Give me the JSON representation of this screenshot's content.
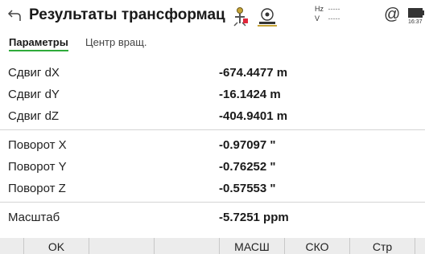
{
  "header": {
    "title": "Результаты трансформац",
    "hz_label": "Hz",
    "hz_value": "-----",
    "v_label": "V",
    "v_value": "-----",
    "at_symbol": "@",
    "time": "16:37",
    "icons": [
      "back-icon",
      "prism-target-icon",
      "instrument-icon",
      "battery-icon"
    ]
  },
  "tabs": [
    {
      "label": "Параметры",
      "active": true
    },
    {
      "label": "Центр вращ.",
      "active": false
    }
  ],
  "rows": [
    {
      "label": "Сдвиг dX",
      "value": "-674.4477 m"
    },
    {
      "label": "Сдвиг dY",
      "value": "-16.1424 m"
    },
    {
      "label": "Сдвиг dZ",
      "value": "-404.9401 m"
    },
    {
      "label": "Поворот X",
      "value": "-0.97097 \""
    },
    {
      "label": "Поворот Y",
      "value": "-0.76252 \""
    },
    {
      "label": "Поворот Z",
      "value": "-0.57553 \""
    },
    {
      "label": "Масштаб",
      "value": "-5.7251 ppm"
    }
  ],
  "softkeys": [
    "OK",
    "",
    "",
    "МАСШ",
    "СКО",
    "Стр"
  ],
  "colors": {
    "accent": "#2eaa3a",
    "softkey_bar": "#ececec"
  }
}
